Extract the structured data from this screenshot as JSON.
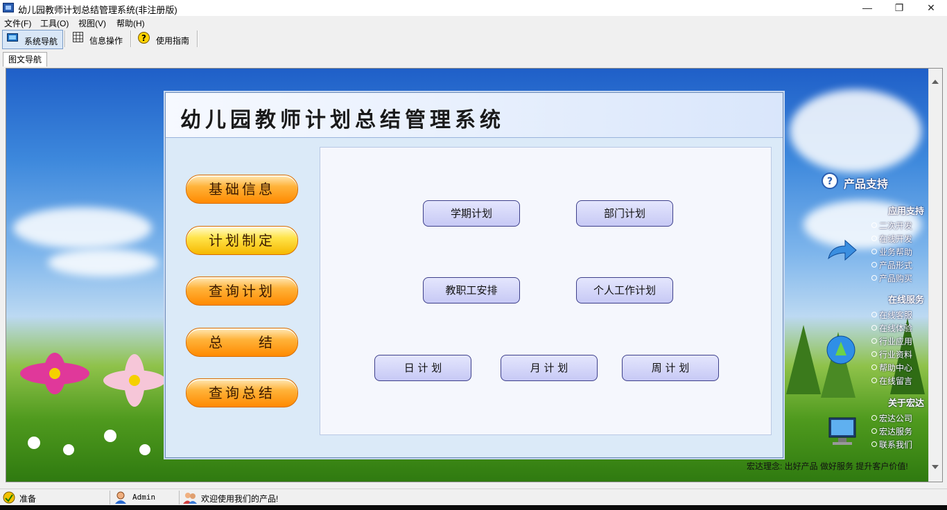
{
  "window": {
    "title": "幼儿园教师计划总结管理系统(非注册版)",
    "controls": {
      "minimize": "—",
      "maximize": "❐",
      "close": "✕"
    }
  },
  "menubar": {
    "items": [
      "文件(F)",
      "工具(O)",
      "视图(V)",
      "帮助(H)"
    ]
  },
  "toolbar": {
    "nav_label": "系统导航",
    "info_label": "信息操作",
    "guide_label": "使用指南",
    "guide_icon": "?"
  },
  "tabs": {
    "active_label": "图文导航"
  },
  "panel": {
    "title": "幼儿园教师计划总结管理系统",
    "left_buttons": [
      "基础信息",
      "计划制定",
      "查询计划",
      "总　　结",
      "查询总结"
    ],
    "plan_buttons": [
      "学期计划",
      "部门计划",
      "教职工安排",
      "个人工作计划",
      "日 计 划",
      "月 计 划",
      "周 计 划"
    ]
  },
  "sidebar": {
    "title": "产品支持",
    "sections": [
      {
        "heading": "应用支持",
        "items": [
          "二次开发",
          "在线开发",
          "业务帮助",
          "产品形式",
          "产品购买"
        ]
      },
      {
        "heading": "在线服务",
        "items": [
          "在线客服",
          "在线体验",
          "行业应用",
          "行业资料",
          "帮助中心",
          "在线留言"
        ]
      },
      {
        "heading": "关于宏达",
        "items": [
          "宏达公司",
          "宏达服务",
          "联系我们"
        ]
      }
    ],
    "slogan": "宏达理念: 出好产品 做好服务 提升客户价值!"
  },
  "statusbar": {
    "ready": "准备",
    "user": "Admin",
    "welcome": "欢迎使用我们的产品!"
  },
  "colors": {
    "accent_orange": "#ff8a00",
    "panel_bg": "#dbeaf8",
    "purple_button": "#c7c9f5"
  }
}
